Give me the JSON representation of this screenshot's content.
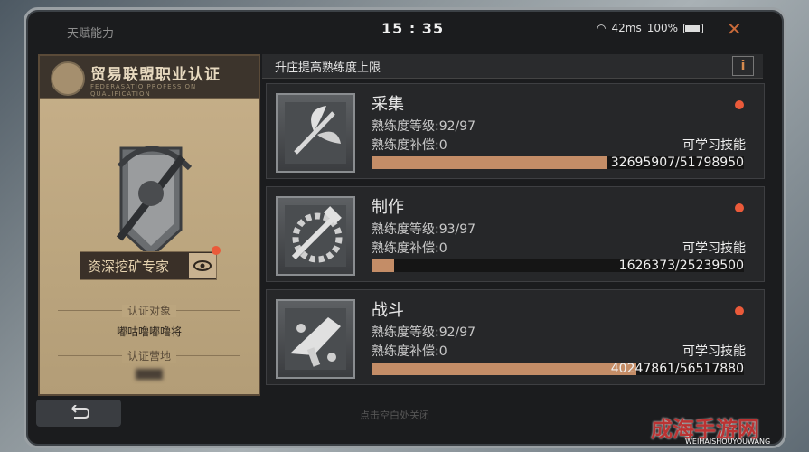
{
  "top": {
    "title": "天赋能力",
    "clock": "15 : 35",
    "signal": "42ms",
    "battery": "100%"
  },
  "card": {
    "title": "贸易联盟职业认证",
    "subtitle": "FEDERASATIO PROFESSION QUALIFICATION",
    "rank": "资深挖矿专家",
    "target_label": "认证对象",
    "target_value": "嘟咕噜嘟噜将",
    "location_label": "认证营地"
  },
  "banner": {
    "text": "升庄提高熟练度上限",
    "info": "i"
  },
  "skills": [
    {
      "name": "采集",
      "level": "熟练度等级:92/97",
      "compensate": "熟练度补偿:0",
      "learnable": "可学习技能",
      "progress": "32695907/51798950",
      "fraction": 0.63
    },
    {
      "name": "制作",
      "level": "熟练度等级:93/97",
      "compensate": "熟练度补偿:0",
      "learnable": "可学习技能",
      "progress": "1626373/25239500",
      "fraction": 0.06
    },
    {
      "name": "战斗",
      "level": "熟练度等级:92/97",
      "compensate": "熟练度补偿:0",
      "learnable": "可学习技能",
      "progress": "40247861/56517880",
      "fraction": 0.71
    }
  ],
  "footer": {
    "hint": "点击空白处关闭"
  },
  "watermark": {
    "brand": "成海手游网",
    "url": "WEIHAISHOUYOUWANG"
  },
  "colors": {
    "accent": "#c48d67",
    "alert": "#ea5a3a"
  }
}
